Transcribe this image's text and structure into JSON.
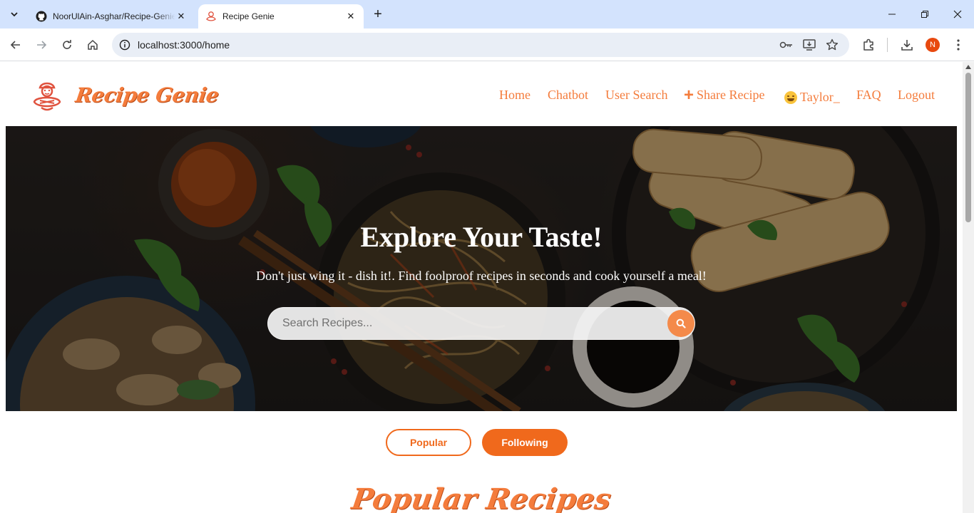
{
  "browser": {
    "tabs": [
      {
        "title": "NoorUlAin-Asghar/Recipe-Genie",
        "icon": "github-icon"
      },
      {
        "title": "Recipe Genie",
        "icon": "recipe-genie-favicon"
      }
    ],
    "url": "localhost:3000/home",
    "profile_initial": "N"
  },
  "site": {
    "logo_text": "Recipe Genie",
    "nav": {
      "home": "Home",
      "chatbot": "Chatbot",
      "user_search": "User Search",
      "share_recipe": "Share Recipe",
      "user": "Taylor_",
      "faq": "FAQ",
      "logout": "Logout"
    },
    "hero": {
      "title": "Explore Your Taste!",
      "subtitle": "Don't just wing it - dish it!. Find foolproof recipes in seconds and cook yourself a meal!",
      "search_placeholder": "Search Recipes..."
    },
    "toggles": {
      "popular": "Popular",
      "following": "Following"
    },
    "section_title": "Popular Recipes",
    "accent_color": "#f47c3c"
  }
}
